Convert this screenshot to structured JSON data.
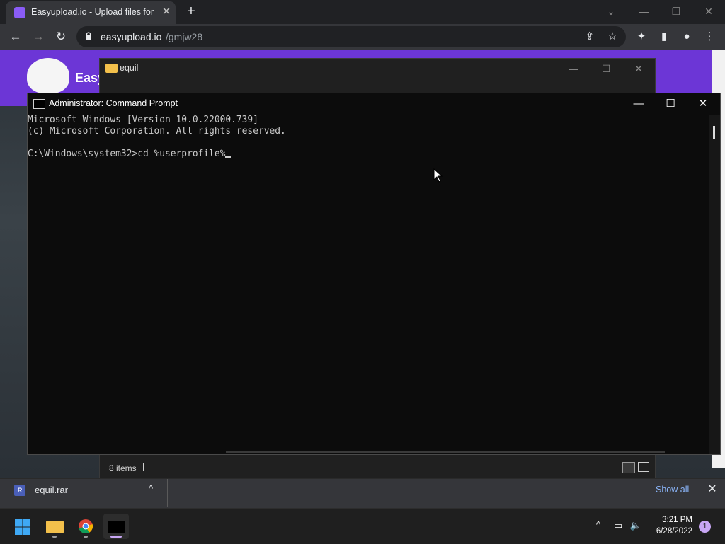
{
  "browser": {
    "tab": {
      "title": "Easyupload.io - Upload files for f",
      "close_glyph": "✕"
    },
    "new_tab_glyph": "+",
    "window_controls": {
      "dropdown": "⌄",
      "minimize": "—",
      "restore": "❐",
      "close": "✕"
    },
    "nav": {
      "back": "←",
      "forward": "→",
      "reload": "↻"
    },
    "address": {
      "host": "easyupload.io",
      "path": "/gmjw28"
    },
    "toolbar_icons": [
      "share-icon",
      "star-icon",
      "extensions-icon",
      "side-panel-icon",
      "profile-icon",
      "menu-icon"
    ]
  },
  "page": {
    "brand_fragment": "Easy"
  },
  "explorer": {
    "title": "equil",
    "status_items": "8 items",
    "controls": {
      "minimize": "—",
      "maximize": "☐",
      "close": "✕"
    }
  },
  "cmd": {
    "title": "Administrator: Command Prompt",
    "lines": [
      "Microsoft Windows [Version 10.0.22000.739]",
      "(c) Microsoft Corporation. All rights reserved.",
      "",
      "C:\\Windows\\system32>cd %userprofile%"
    ],
    "controls": {
      "minimize": "—",
      "maximize": "☐",
      "close": "✕"
    }
  },
  "downloads": {
    "file_name": "equil.rar",
    "file_icon_text": "R",
    "show_all": "Show all",
    "close_glyph": "✕",
    "chevron": "^"
  },
  "taskbar": {
    "apps": [
      "start",
      "file-explorer",
      "chrome",
      "terminal"
    ],
    "tray_chevron": "^",
    "time": "3:21 PM",
    "date": "6/28/2022",
    "notification_count": "1"
  },
  "colors": {
    "accent_purple": "#6c36d6",
    "link_blue": "#8ab4f8",
    "cmd_bg": "#0c0c0c",
    "cmd_text": "#cccccc"
  }
}
